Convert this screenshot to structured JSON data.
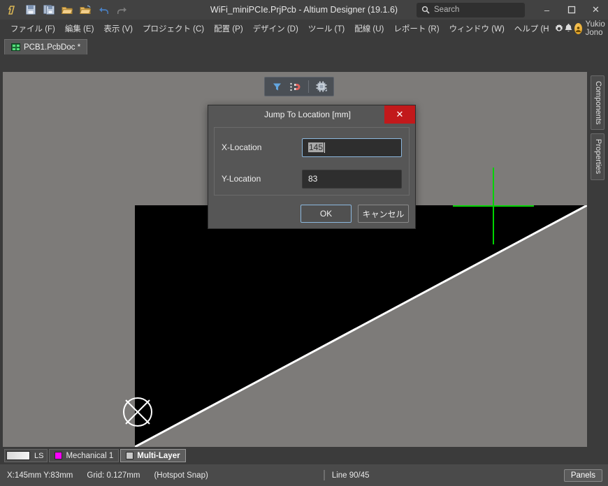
{
  "window": {
    "title": "WiFi_miniPCIe.PrjPcb - Altium Designer (19.1.6)",
    "minimize_label": "–",
    "maximize_label": "❑",
    "close_label": "✕"
  },
  "search": {
    "placeholder": "Search",
    "icon": "search-icon"
  },
  "quick_access": [
    {
      "name": "altium-logo-icon",
      "label": "A"
    },
    {
      "name": "save-icon",
      "label": ""
    },
    {
      "name": "save-all-icon",
      "label": ""
    },
    {
      "name": "open-icon",
      "label": ""
    },
    {
      "name": "open-project-icon",
      "label": ""
    },
    {
      "name": "undo-icon",
      "label": ""
    },
    {
      "name": "redo-icon",
      "label": ""
    }
  ],
  "menu": [
    {
      "text": "ファイル (F)",
      "accel": "F"
    },
    {
      "text": "編集 (E)",
      "accel": "E"
    },
    {
      "text": "表示 (V)",
      "accel": "V"
    },
    {
      "text": "プロジェクト (C)",
      "accel": "C"
    },
    {
      "text": "配置 (P)",
      "accel": "P"
    },
    {
      "text": "デザイン (D)",
      "accel": "D"
    },
    {
      "text": "ツール (T)",
      "accel": "T"
    },
    {
      "text": "配線 (U)",
      "accel": "U"
    },
    {
      "text": "レポート (R)",
      "accel": "R"
    },
    {
      "text": "ウィンドウ (W)",
      "accel": "W"
    },
    {
      "text": "ヘルプ (H",
      "accel": "H"
    }
  ],
  "menubar_icons": [
    {
      "name": "settings-gear-icon",
      "glyph": "⚙"
    },
    {
      "name": "notifications-bell-icon",
      "glyph": "🔔"
    }
  ],
  "user": {
    "name": "Yukio Jono",
    "avatar_initial": "Ⓐ",
    "chevron": "▾"
  },
  "document_tabs": [
    {
      "label": "PCB1.PcbDoc *",
      "icon": "pcb-document-icon",
      "active": true
    }
  ],
  "float_toolbar": [
    {
      "name": "filter-funnel-icon",
      "glyph": "▼"
    },
    {
      "name": "snap-magnet-icon",
      "glyph": "⫼"
    },
    {
      "name": "component-chip-icon",
      "glyph": "▣"
    }
  ],
  "dock_tabs": [
    {
      "label": "Components"
    },
    {
      "label": "Properties"
    }
  ],
  "dialog": {
    "title": "Jump To Location [mm]",
    "close_label": "✕",
    "fields": [
      {
        "label": "X-Location",
        "value": "145",
        "selected": true
      },
      {
        "label": "Y-Location",
        "value": "83",
        "selected": false
      }
    ],
    "ok_label": "OK",
    "cancel_label": "キャンセル"
  },
  "layer_bar": {
    "ls_label": "LS",
    "layers": [
      {
        "label": "Mechanical 1",
        "color": "#ff00ff",
        "active": false
      },
      {
        "label": "Multi-Layer",
        "color": "#c9c9c9",
        "active": true
      }
    ]
  },
  "status_bar": {
    "coordinates": "X:145mm  Y:83mm",
    "grid": "Grid: 0.127mm",
    "snap_mode": "(Hotspot Snap)",
    "line_mode": "Line 90/45",
    "panels_label": "Panels"
  },
  "colors": {
    "canvas_bg": "#7d7b79",
    "board": "#000000",
    "cursor": "#00d400",
    "accent_blue": "#8cb8de",
    "close_red": "#c2191b",
    "mech1": "#ff00ff"
  }
}
